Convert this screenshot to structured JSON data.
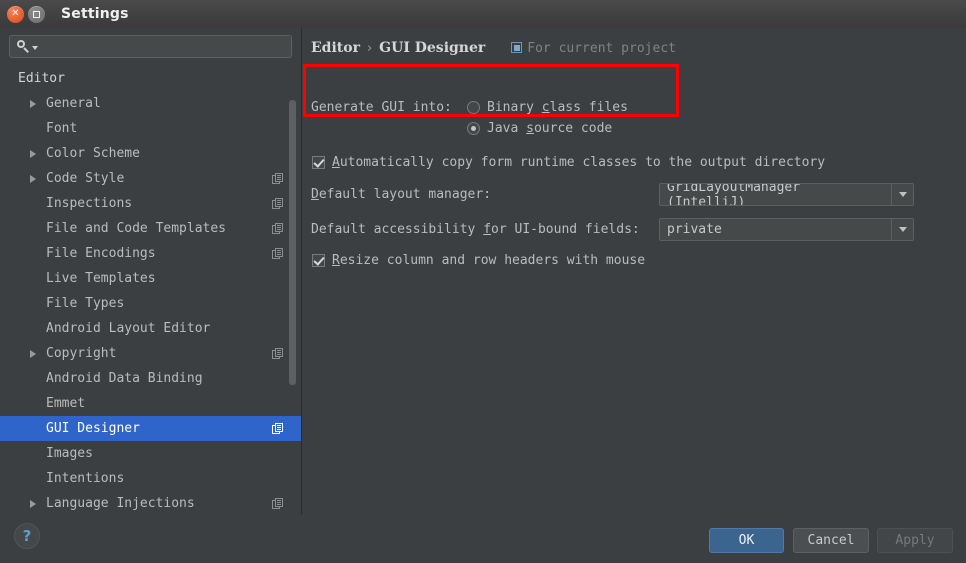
{
  "window": {
    "title": "Settings",
    "close_icon": "close-icon",
    "maximize_icon": "maximize-icon"
  },
  "search": {
    "value": "",
    "placeholder": "",
    "icon": "search-icon",
    "caret_icon": "chevron-down-icon"
  },
  "sidebar": {
    "root_label": "Editor",
    "items": [
      {
        "label": "General",
        "arrow": true,
        "copy": false
      },
      {
        "label": "Font",
        "arrow": false,
        "copy": false
      },
      {
        "label": "Color Scheme",
        "arrow": true,
        "copy": false
      },
      {
        "label": "Code Style",
        "arrow": true,
        "copy": true
      },
      {
        "label": "Inspections",
        "arrow": false,
        "copy": true
      },
      {
        "label": "File and Code Templates",
        "arrow": false,
        "copy": true
      },
      {
        "label": "File Encodings",
        "arrow": false,
        "copy": true
      },
      {
        "label": "Live Templates",
        "arrow": false,
        "copy": false
      },
      {
        "label": "File Types",
        "arrow": false,
        "copy": false
      },
      {
        "label": "Android Layout Editor",
        "arrow": false,
        "copy": false
      },
      {
        "label": "Copyright",
        "arrow": true,
        "copy": true
      },
      {
        "label": "Android Data Binding",
        "arrow": false,
        "copy": false
      },
      {
        "label": "Emmet",
        "arrow": false,
        "copy": false
      },
      {
        "label": "GUI Designer",
        "arrow": false,
        "copy": true,
        "selected": true
      },
      {
        "label": "Images",
        "arrow": false,
        "copy": false
      },
      {
        "label": "Intentions",
        "arrow": false,
        "copy": false
      },
      {
        "label": "Language Injections",
        "arrow": true,
        "copy": true
      }
    ],
    "selection_color": "#2f65ca"
  },
  "pane": {
    "breadcrumb": {
      "parent": "Editor",
      "separator": "›",
      "current": "GUI Designer"
    },
    "project_scope": {
      "label": "For current project",
      "icon": "project-scope-icon"
    },
    "generate_group": {
      "label": "Generate GUI into:",
      "options": [
        {
          "label_before": "Binary ",
          "mnemonic": "c",
          "label_after": "lass files",
          "selected": false
        },
        {
          "label_before": "Java ",
          "mnemonic": "s",
          "label_after": "ource code",
          "selected": true
        }
      ],
      "highlight_color": "#ff0000"
    },
    "auto_copy": {
      "mnemonic": "A",
      "label_after": "utomatically copy form runtime classes to the output directory",
      "checked": true
    },
    "layout_manager": {
      "mnemonic": "D",
      "label_after": "efault layout manager:",
      "value": "GridLayoutManager (IntelliJ)",
      "arrow_icon": "chevron-down-icon"
    },
    "accessibility": {
      "label_1": "Default accessibility ",
      "mnemonic": "f",
      "label_2": "or UI-bound fields:",
      "value": "private",
      "arrow_icon": "chevron-down-icon"
    },
    "resize_headers": {
      "mnemonic": "R",
      "label_after": "esize column and row headers with mouse",
      "checked": true
    }
  },
  "footer": {
    "help_label": "?",
    "ok_label": "OK",
    "cancel_label": "Cancel",
    "apply_label": "Apply"
  }
}
